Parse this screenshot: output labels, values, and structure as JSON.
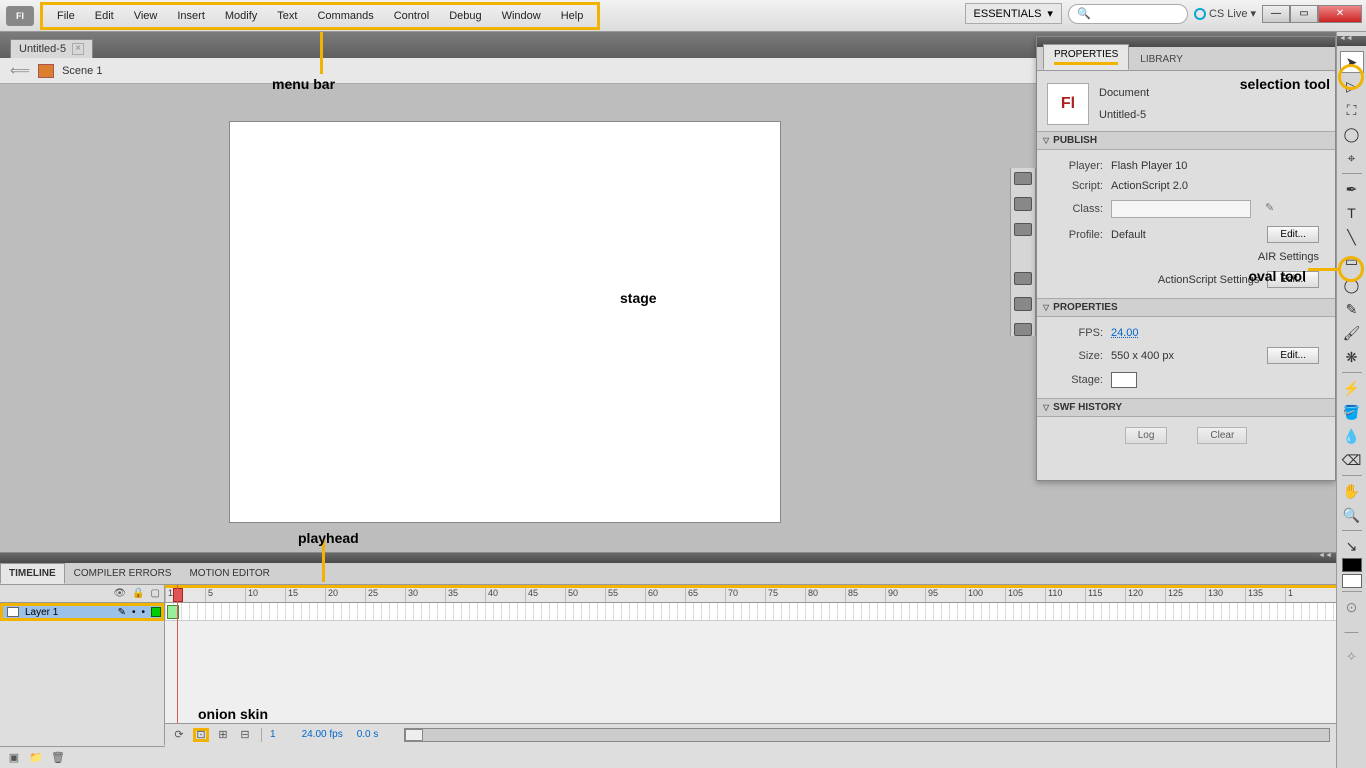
{
  "app": {
    "icon_text": "Fl"
  },
  "menu": {
    "items": [
      "File",
      "Edit",
      "View",
      "Insert",
      "Modify",
      "Text",
      "Commands",
      "Control",
      "Debug",
      "Window",
      "Help"
    ]
  },
  "top_right": {
    "workspace": "ESSENTIALS",
    "search_placeholder": "",
    "cs_live": "CS Live"
  },
  "document": {
    "tab_name": "Untitled-5",
    "scene": "Scene 1"
  },
  "annotations": {
    "menu_bar": "menu bar",
    "stage": "stage",
    "selection_tool": "selection tool",
    "oval_tool": "oval tool",
    "playhead": "playhead",
    "onion_skin": "onion skin"
  },
  "panels": {
    "properties_tab": "PROPERTIES",
    "library_tab": "LIBRARY",
    "doc_type": "Document",
    "doc_name": "Untitled-5",
    "sections": {
      "publish": "PUBLISH",
      "properties": "PROPERTIES",
      "swf_history": "SWF HISTORY"
    },
    "publish": {
      "player_label": "Player:",
      "player_value": "Flash Player 10",
      "script_label": "Script:",
      "script_value": "ActionScript 2.0",
      "class_label": "Class:",
      "profile_label": "Profile:",
      "profile_value": "Default",
      "edit_btn": "Edit...",
      "air_settings": "AIR Settings",
      "as_settings": "ActionScript Settings"
    },
    "props": {
      "fps_label": "FPS:",
      "fps_value": "24.00",
      "size_label": "Size:",
      "size_value": "550 x 400 px",
      "stage_label": "Stage:",
      "edit_btn": "Edit..."
    },
    "swf": {
      "log_btn": "Log",
      "clear_btn": "Clear"
    }
  },
  "timeline": {
    "tabs": {
      "timeline": "TIMELINE",
      "compiler": "COMPILER ERRORS",
      "motion": "MOTION EDITOR"
    },
    "layer_name": "Layer 1",
    "ruler_ticks": [
      "1",
      "5",
      "10",
      "15",
      "20",
      "25",
      "30",
      "35",
      "40",
      "45",
      "50",
      "55",
      "60",
      "65",
      "70",
      "75",
      "80",
      "85",
      "90",
      "95",
      "100",
      "105",
      "110",
      "115",
      "120",
      "125",
      "130",
      "135",
      "1"
    ],
    "footer": {
      "frame": "1",
      "fps": "24.00 fps",
      "time": "0.0 s"
    }
  }
}
